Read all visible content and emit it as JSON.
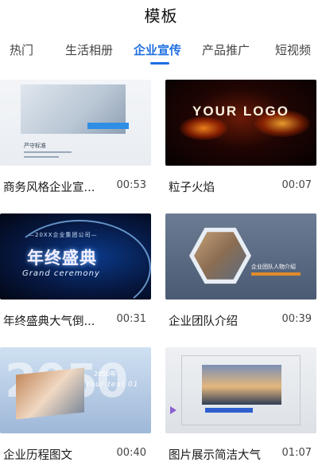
{
  "header": {
    "title": "模板"
  },
  "tabs": [
    {
      "label": "热门",
      "active": false
    },
    {
      "label": "生活相册",
      "active": false
    },
    {
      "label": "企业宣传",
      "active": true
    },
    {
      "label": "产品推广",
      "active": false
    },
    {
      "label": "短视频",
      "active": false
    }
  ],
  "accent_color": "#1f6fe0",
  "templates": [
    {
      "title": "商务风格企业宣...",
      "duration": "00:53",
      "thumb_text": {
        "caption": "严守标准"
      }
    },
    {
      "title": "粒子火焰",
      "duration": "00:07",
      "thumb_text": {
        "logo": "YOUR LOGO"
      }
    },
    {
      "title": "年终盛典大气倒...",
      "duration": "00:31",
      "thumb_text": {
        "small": "—20XX企业集团公司—",
        "big": "年终盛典",
        "eng": "Grand ceremony"
      }
    },
    {
      "title": "企业团队介绍",
      "duration": "00:39",
      "thumb_text": {
        "label": "企业团队人物介绍"
      }
    },
    {
      "title": "企业历程图文",
      "duration": "00:40",
      "thumb_text": {
        "num": "2050",
        "year": "2050年",
        "text": "Your text 01"
      }
    },
    {
      "title": "图片展示简洁大气",
      "duration": "01:07",
      "thumb_text": {}
    }
  ]
}
